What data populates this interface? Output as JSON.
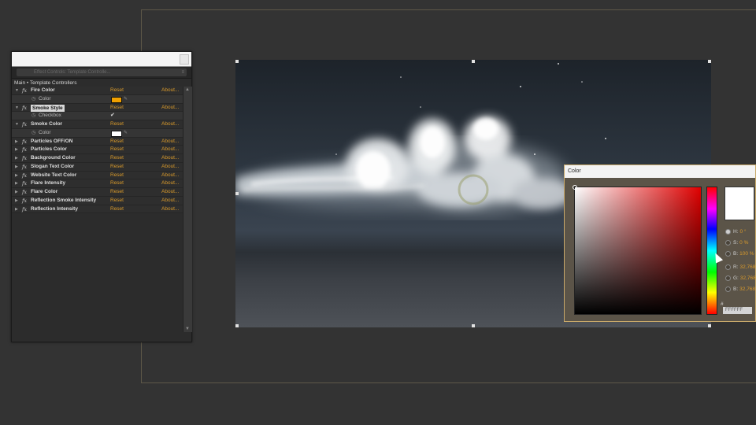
{
  "effect_controls": {
    "tab_label": "Effect Controls: Template Controlle...",
    "breadcrumb": "Main • Template Controllers",
    "reset_label": "Reset",
    "about_label": "About...",
    "effects": [
      {
        "name": "Fire Color",
        "expanded": true,
        "selected": false,
        "param": {
          "kind": "color",
          "label": "Color",
          "value": "#f0a000"
        }
      },
      {
        "name": "Smoke Style",
        "expanded": true,
        "selected": true,
        "param": {
          "kind": "checkbox",
          "label": "Checkbox",
          "checked": true
        }
      },
      {
        "name": "Smoke Color",
        "expanded": true,
        "selected": false,
        "param": {
          "kind": "color",
          "label": "Color",
          "value": "#ffffff"
        }
      },
      {
        "name": "Particles OFF/ON",
        "expanded": false
      },
      {
        "name": "Particles Color",
        "expanded": false
      },
      {
        "name": "Background Color",
        "expanded": false
      },
      {
        "name": "Slogan Text Color",
        "expanded": false
      },
      {
        "name": "Website Text Color",
        "expanded": false
      },
      {
        "name": "Flare Intensity",
        "expanded": false
      },
      {
        "name": "Flare Color",
        "expanded": false
      },
      {
        "name": "Reflection Smoke Intensity",
        "expanded": false
      },
      {
        "name": "Reflection Intensity",
        "expanded": false
      }
    ]
  },
  "color_picker": {
    "title": "Color",
    "preview_color": "#ffffff",
    "fields": [
      {
        "label": "H:",
        "value": "0 °",
        "selected": true
      },
      {
        "label": "S:",
        "value": "0 %",
        "selected": false
      },
      {
        "label": "B:",
        "value": "100 %",
        "selected": false
      },
      {
        "label": "R:",
        "value": "32,768",
        "selected": false
      },
      {
        "label": "G:",
        "value": "32,768",
        "selected": false
      },
      {
        "label": "B:",
        "value": "32,768",
        "selected": false
      }
    ],
    "hex_prefix": "#",
    "hex_value": "FFFFFF"
  },
  "colors": {
    "accent_link": "#d99a2b",
    "picker_border": "#c8a96a"
  }
}
